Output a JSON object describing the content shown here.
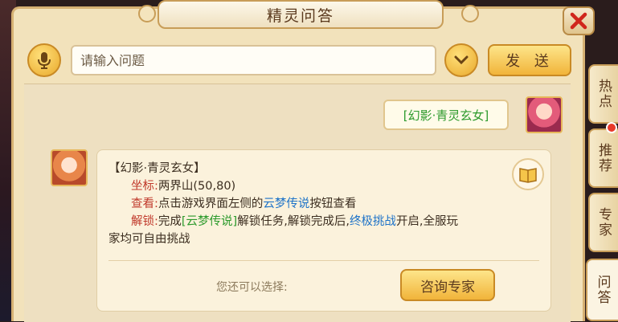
{
  "window": {
    "title": "精灵问答"
  },
  "input": {
    "placeholder": "请输入问题",
    "send_label": "发 送"
  },
  "tabs": [
    {
      "label": "热点"
    },
    {
      "label": "推荐"
    },
    {
      "label": "专家"
    },
    {
      "label": "问答"
    }
  ],
  "user_message": "[幻影·青灵玄女]",
  "reply": {
    "heading": "【幻影·青灵玄女】",
    "coord_label": "坐标:",
    "coord_value": "两界山(50,80)",
    "view_label": "查看:",
    "view_text_a": "点击游戏界面左侧的",
    "view_link": "云梦传说",
    "view_text_b": "按钮查看",
    "unlock_label": "解锁:",
    "unlock_text_a": "完成",
    "unlock_link": "[云梦传说]",
    "unlock_text_b": "解锁任务,解锁完成后,",
    "unlock_link2": "终极挑战",
    "unlock_text_c": "开启,全服玩",
    "unlock_text_d": "家均可自由挑战"
  },
  "footer": {
    "choose_label": "您还可以选择:",
    "expert_button": "咨询专家"
  },
  "icons": {
    "close": "close-icon",
    "mic": "microphone-icon",
    "dropdown": "chevron-down-icon",
    "book": "book-icon"
  },
  "colors": {
    "panel": "#f2e2bb",
    "accent": "#f1b43a",
    "link_blue": "#1e73c8",
    "link_green": "#2c9a2c",
    "label_red": "#c0392b"
  }
}
